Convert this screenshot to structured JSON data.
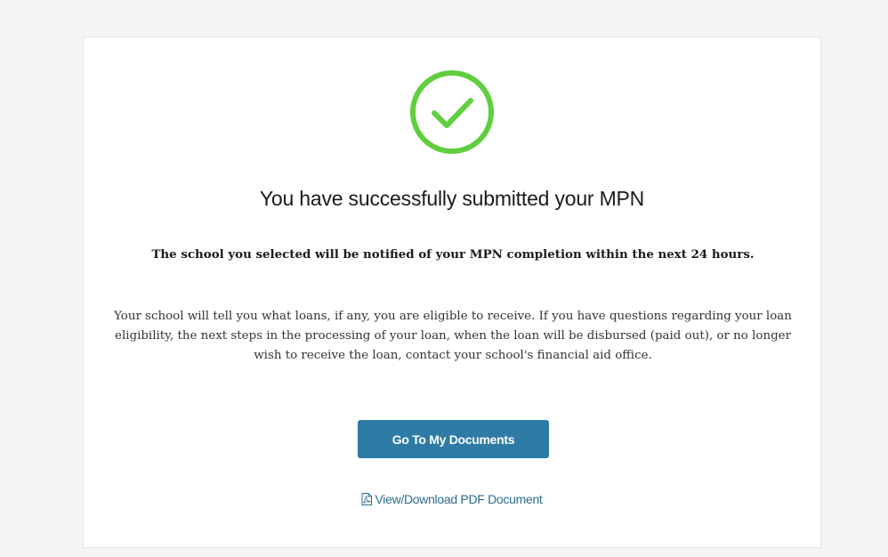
{
  "confirmation": {
    "headline": "You have successfully submitted your MPN",
    "notice": "The school you selected will be notified of your MPN completion within the next 24 hours.",
    "body": "Your school will tell you what loans, if any, you are eligible to receive. If you have questions regarding your loan eligibility, the next steps in the processing of your loan, when the loan will be disbursed (paid out), or no longer wish to receive the loan, contact your school's financial aid office.",
    "primary_button_label": "Go To My Documents",
    "pdf_link_label": "View/Download PDF Document"
  },
  "icons": {
    "status": "success-check-icon",
    "pdf": "pdf-file-icon"
  },
  "colors": {
    "success_green": "#5fcf3e",
    "primary_button": "#2e7ca6",
    "link": "#2e6b8f"
  }
}
